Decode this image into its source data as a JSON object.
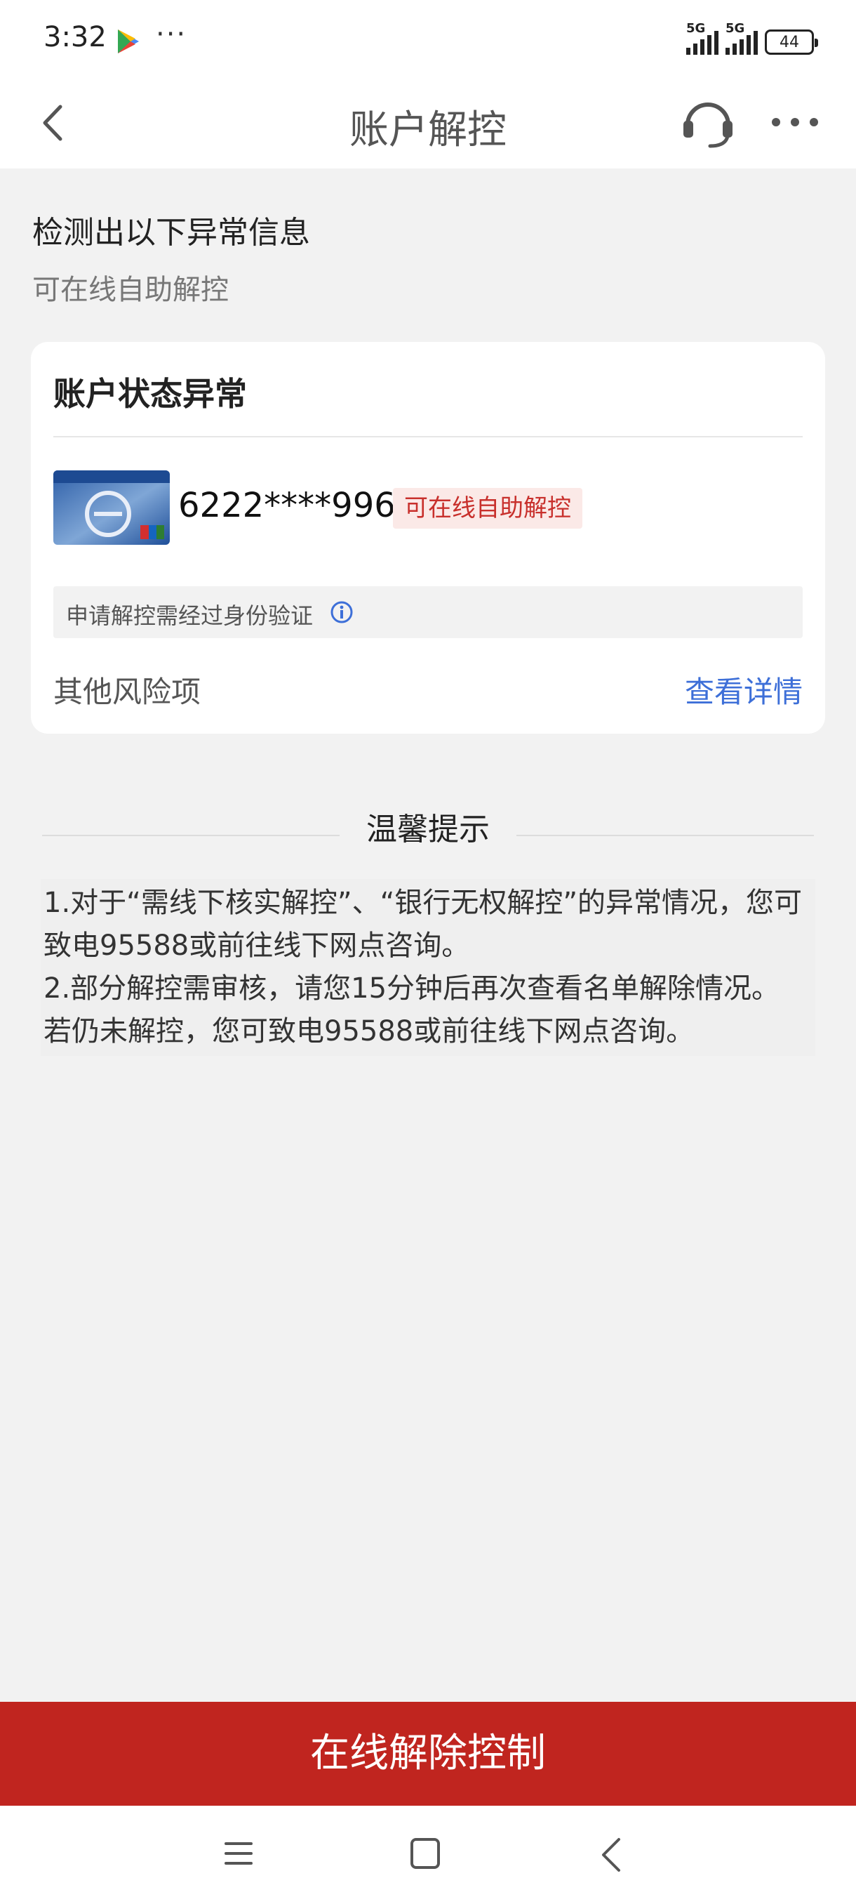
{
  "status_bar": {
    "time": "3:32",
    "more": "···",
    "signal_1": "5G",
    "signal_2": "5G",
    "battery": "44"
  },
  "nav": {
    "title": "账户解控",
    "icons": [
      "back-icon",
      "headset-icon",
      "more-icon"
    ]
  },
  "intro": {
    "title": "检测出以下异常信息",
    "subtitle": "可在线自助解控"
  },
  "card": {
    "title": "账户状态异常",
    "card_number": "6222****9966",
    "status_badge": "可在线自助解控",
    "notice": "申请解控需经过身份验证",
    "risk_label": "其他风险项",
    "detail_link": "查看详情"
  },
  "tips": {
    "title": "温馨提示",
    "lines": [
      "1.对于“需线下核实解控”、“银行无权解控”的异常情况，您可",
      "致电95588或前往线下网点咨询。",
      "2.部分解控需审核，请您15分钟后再次查看名单解除情况。",
      "若仍未解控，您可致电95588或前往线下网点咨询。"
    ]
  },
  "primary_button": "在线解除控制",
  "colors": {
    "brand_red": "#c0251f",
    "badge_red": "#c8302c",
    "link_blue": "#3d6fd8",
    "background": "#f2f2f2"
  }
}
